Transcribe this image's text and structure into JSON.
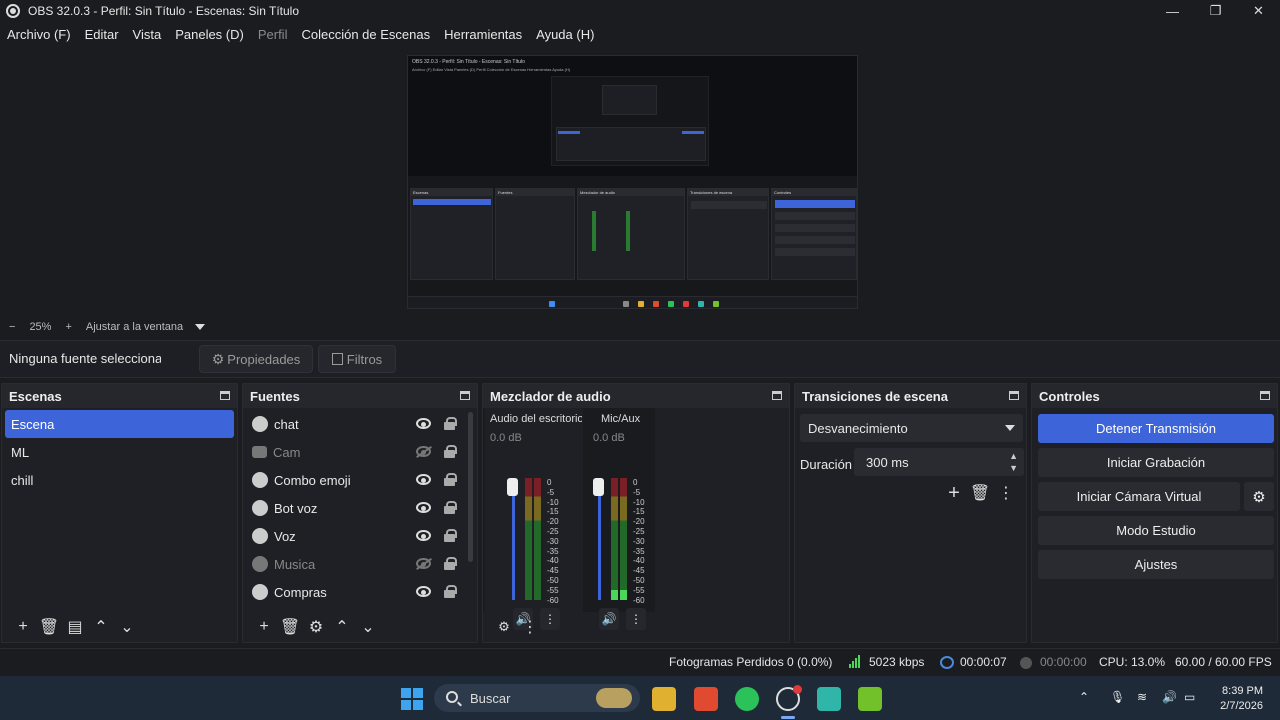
{
  "window": {
    "title": "OBS 32.0.3 - Perfil: Sin Título - Escenas: Sin Título",
    "minimize": "—",
    "maximize": "❐",
    "close": "✕"
  },
  "menu": [
    {
      "label": "Archivo (F)",
      "disabled": false
    },
    {
      "label": "Editar",
      "disabled": false
    },
    {
      "label": "Vista",
      "disabled": false
    },
    {
      "label": "Paneles (D)",
      "disabled": false
    },
    {
      "label": "Perfil",
      "disabled": true
    },
    {
      "label": "Colección de Escenas",
      "disabled": false
    },
    {
      "label": "Herramientas",
      "disabled": false
    },
    {
      "label": "Ayuda (H)",
      "disabled": false
    }
  ],
  "zoom": {
    "minus": "−",
    "value": "25%",
    "plus": "+",
    "fit": "Ajustar a la ventana"
  },
  "source_bar": {
    "no_source": "Ninguna fuente seleccionada",
    "properties": "Propiedades",
    "filters": "Filtros"
  },
  "scenes": {
    "title": "Escenas",
    "items": [
      {
        "label": "Escena",
        "active": true
      },
      {
        "label": "ML",
        "active": false
      },
      {
        "label": "chill",
        "active": false
      }
    ]
  },
  "sources": {
    "title": "Fuentes",
    "items": [
      {
        "label": "chat",
        "visible": true,
        "icon": "browser-icon"
      },
      {
        "label": "Cam",
        "visible": false,
        "icon": "camera-icon"
      },
      {
        "label": "Combo emoji",
        "visible": true,
        "icon": "browser-icon"
      },
      {
        "label": "Bot voz",
        "visible": true,
        "icon": "browser-icon"
      },
      {
        "label": "Voz",
        "visible": true,
        "icon": "browser-icon"
      },
      {
        "label": "Musica",
        "visible": false,
        "icon": "browser-icon"
      },
      {
        "label": "Compras",
        "visible": true,
        "icon": "browser-icon"
      }
    ]
  },
  "mixer": {
    "title": "Mezclador de audio",
    "channels": [
      {
        "name": "Audio del escritorio",
        "db": "0.0 dB",
        "level": 0.0
      },
      {
        "name": "Mic/Aux",
        "db": "0.0 dB",
        "level": 0.08
      }
    ],
    "scale": [
      "0",
      "-5",
      "-10",
      "-15",
      "-20",
      "-25",
      "-30",
      "-35",
      "-40",
      "-45",
      "-50",
      "-55",
      "-60"
    ]
  },
  "transitions": {
    "title": "Transiciones de escena",
    "selected": "Desvanecimiento",
    "duration_label": "Duración",
    "duration_value": "300 ms"
  },
  "controls": {
    "title": "Controles",
    "stop_stream": "Detener Transmisión",
    "start_recording": "Iniciar Grabación",
    "virtual_cam": "Iniciar Cámara Virtual",
    "studio_mode": "Modo Estudio",
    "settings": "Ajustes"
  },
  "status": {
    "dropped": "Fotogramas Perdidos 0 (0.0%)",
    "bitrate": "5023 kbps",
    "stream_time": "00:00:07",
    "rec_time": "00:00:00",
    "cpu": "CPU: 13.0%",
    "fps": "60.00 / 60.00 FPS"
  },
  "taskbar": {
    "search_placeholder": "Buscar",
    "time": "8:39 PM",
    "date": "2/7/2026"
  },
  "preview_thumbnail": {
    "title": "OBS 32.0.3 - Perfil: Sin Título - Escenas: Sin Título",
    "menu": "Archivo (F)  Editar  Vista  Paneles (D)  Perfil  Colección de Escenas  Herramientas  Ayuda (H)",
    "panels": [
      "Escenas",
      "Fuentes",
      "Mezclador de audio",
      "Transiciones de escena",
      "Controles"
    ]
  },
  "colors": {
    "accent": "#3d64d8",
    "panel_bg": "#1f2025",
    "meter_green": "#4bd65a"
  }
}
